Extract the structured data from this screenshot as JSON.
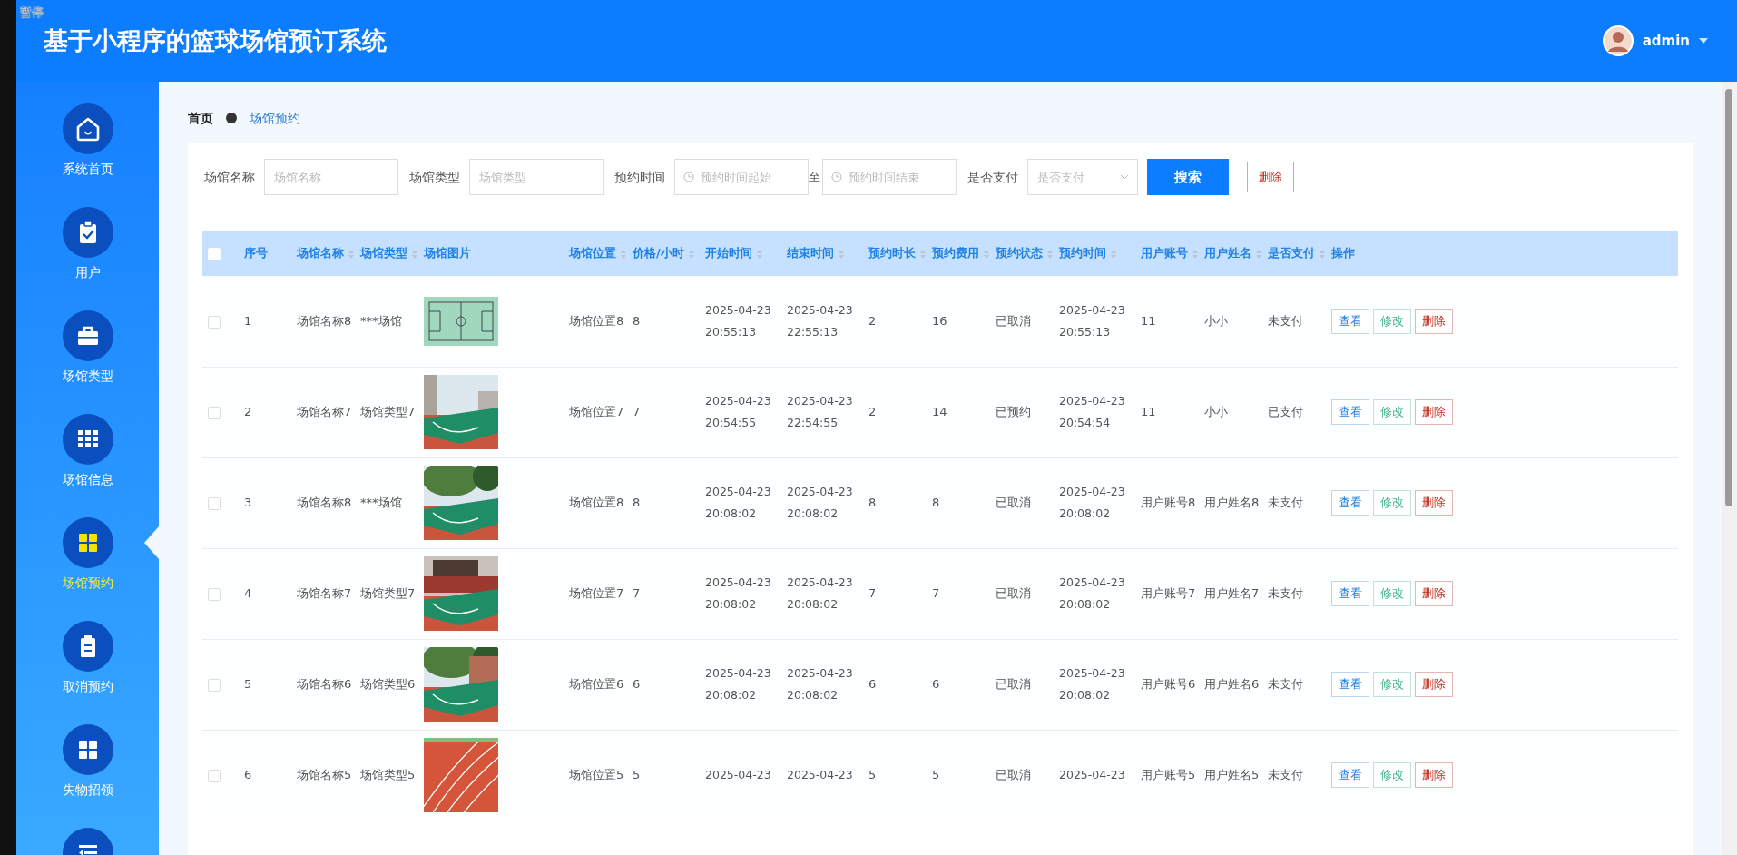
{
  "pause_label": "暂停",
  "header": {
    "title": "基于小程序的篮球场馆预订系统",
    "user": "admin"
  },
  "sidebar": {
    "items": [
      {
        "label": "系统首页",
        "selected": false
      },
      {
        "label": "用户",
        "selected": false
      },
      {
        "label": "场馆类型",
        "selected": false
      },
      {
        "label": "场馆信息",
        "selected": false
      },
      {
        "label": "场馆预约",
        "selected": true
      },
      {
        "label": "取消预约",
        "selected": false
      },
      {
        "label": "失物招领",
        "selected": false
      },
      {
        "selected": false
      }
    ]
  },
  "breadcrumb": [
    {
      "label": "首页"
    },
    {
      "label": "场馆预约"
    }
  ],
  "filters": [
    {
      "kind": "text",
      "label": "场馆名称",
      "placeholder": "场馆名称"
    },
    {
      "kind": "text",
      "label": "场馆类型",
      "placeholder": "场馆类型"
    },
    {
      "kind": "daterange",
      "label": "预约时间",
      "placeholder": "预约时间起始",
      "separator": "至",
      "placeholder_end": "预约时间结束"
    },
    {
      "kind": "select",
      "label": "是否支付",
      "placeholder": "是否支付"
    }
  ],
  "search_button": "搜索",
  "delete_button": "删除",
  "table": {
    "select_all_checked": false,
    "columns": [
      {
        "label": "序号",
        "sortable": false
      },
      {
        "label": "场馆名称",
        "sortable": true
      },
      {
        "label": "场馆类型",
        "sortable": true
      },
      {
        "label": "场馆图片",
        "sortable": false
      },
      {
        "label": "场馆位置",
        "sortable": true
      },
      {
        "label": "价格/小时",
        "sortable": true
      },
      {
        "label": "开始时间",
        "sortable": true
      },
      {
        "label": "结束时间",
        "sortable": true
      },
      {
        "label": "预约时长",
        "sortable": true
      },
      {
        "label": "预约费用",
        "sortable": true
      },
      {
        "label": "预约状态",
        "sortable": true
      },
      {
        "label": "预约时间",
        "sortable": true
      },
      {
        "label": "用户账号",
        "sortable": true
      },
      {
        "label": "用户姓名",
        "sortable": true
      },
      {
        "label": "是否支付",
        "sortable": true
      },
      {
        "label": "操作",
        "sortable": false
      }
    ],
    "rows": [
      {
        "checked": false,
        "cells": [
          "1",
          "场馆名称8",
          "***场馆",
          {
            "kind": "picture"
          },
          "场馆位置8",
          "8",
          "2025-04-23 20:55:13",
          "2025-04-23 22:55:13",
          "2",
          "16",
          "已取消",
          "2025-04-23 20:55:13",
          "11",
          "小小",
          "未支付"
        ],
        "actions": [
          "查看",
          "修改",
          "删除"
        ]
      },
      {
        "checked": false,
        "cells": [
          "2",
          "场馆名称7",
          "场馆类型7",
          {
            "kind": "picture"
          },
          "场馆位置7",
          "7",
          "2025-04-23 20:54:55",
          "2025-04-23 22:54:55",
          "2",
          "14",
          "已预约",
          "2025-04-23 20:54:54",
          "11",
          "小小",
          "已支付"
        ],
        "actions": [
          "查看",
          "修改",
          "删除"
        ]
      },
      {
        "checked": false,
        "cells": [
          "3",
          "场馆名称8",
          "***场馆",
          {
            "kind": "picture"
          },
          "场馆位置8",
          "8",
          "2025-04-23 20:08:02",
          "2025-04-23 20:08:02",
          "8",
          "8",
          "已取消",
          "2025-04-23 20:08:02",
          "用户账号8",
          "用户姓名8",
          "未支付"
        ],
        "actions": [
          "查看",
          "修改",
          "删除"
        ]
      },
      {
        "checked": false,
        "cells": [
          "4",
          "场馆名称7",
          "场馆类型7",
          {
            "kind": "picture"
          },
          "场馆位置7",
          "7",
          "2025-04-23 20:08:02",
          "2025-04-23 20:08:02",
          "7",
          "7",
          "已取消",
          "2025-04-23 20:08:02",
          "用户账号7",
          "用户姓名7",
          "未支付"
        ],
        "actions": [
          "查看",
          "修改",
          "删除"
        ]
      },
      {
        "checked": false,
        "cells": [
          "5",
          "场馆名称6",
          "场馆类型6",
          {
            "kind": "picture"
          },
          "场馆位置6",
          "6",
          "2025-04-23 20:08:02",
          "2025-04-23 20:08:02",
          "6",
          "6",
          "已取消",
          "2025-04-23 20:08:02",
          "用户账号6",
          "用户姓名6",
          "未支付"
        ],
        "actions": [
          "查看",
          "修改",
          "删除"
        ]
      },
      {
        "checked": false,
        "cells": [
          "6",
          "场馆名称5",
          "场馆类型5",
          {
            "kind": "picture"
          },
          "场馆位置5",
          "5",
          "2025-04-23",
          "2025-04-23",
          "5",
          "5",
          "已取消",
          "2025-04-23",
          "用户账号5",
          "用户姓名5",
          "未支付"
        ],
        "actions": [
          "查看",
          "修改",
          "删除"
        ]
      }
    ]
  }
}
